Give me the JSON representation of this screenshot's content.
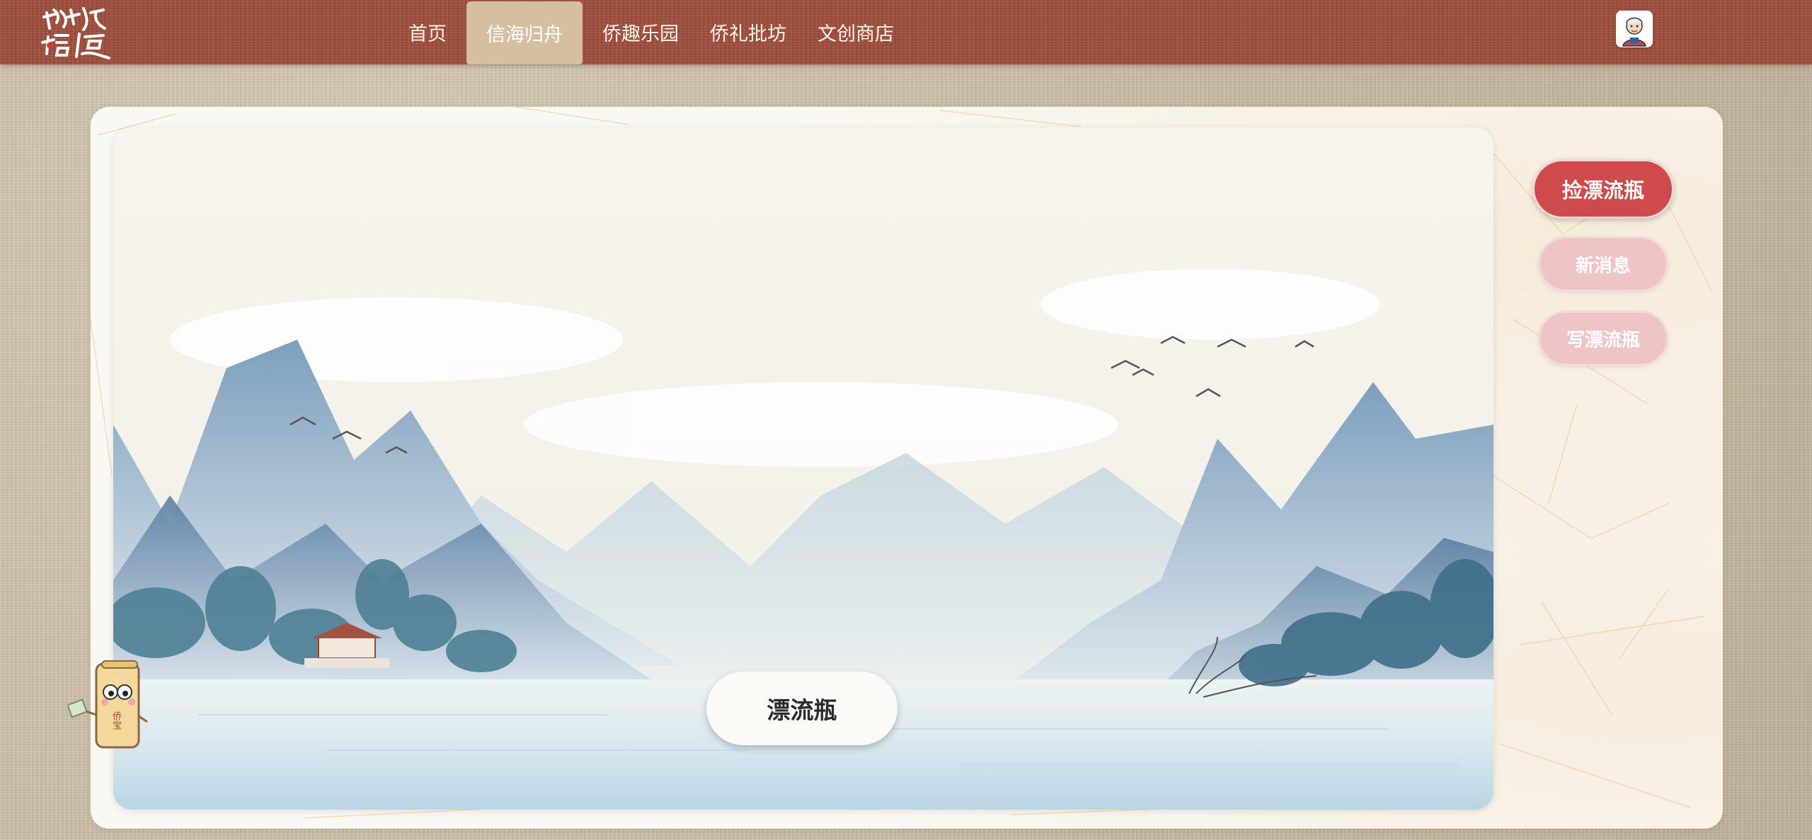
{
  "header": {
    "logo_text": "侨缘信使",
    "nav": [
      {
        "label": "首页",
        "active": false
      },
      {
        "label": "信海归舟",
        "active": true
      },
      {
        "label": "侨趣乐园",
        "active": false
      },
      {
        "label": "侨礼批坊",
        "active": false
      },
      {
        "label": "文创商店",
        "active": false
      }
    ],
    "avatar_icon": "user-avatar-icon"
  },
  "main": {
    "center_button_label": "漂流瓶",
    "actions": {
      "pick_label": "捡漂流瓶",
      "messages_label": "新消息",
      "write_label": "写漂流瓶"
    },
    "mascot_text": "侨宝"
  },
  "colors": {
    "header_bg": "#a14e3c",
    "active_tab_bg": "#d4bfa0",
    "primary_button": "#cf4a4a",
    "secondary_button": "#efc4c7",
    "page_bg": "#cbbfa9"
  }
}
